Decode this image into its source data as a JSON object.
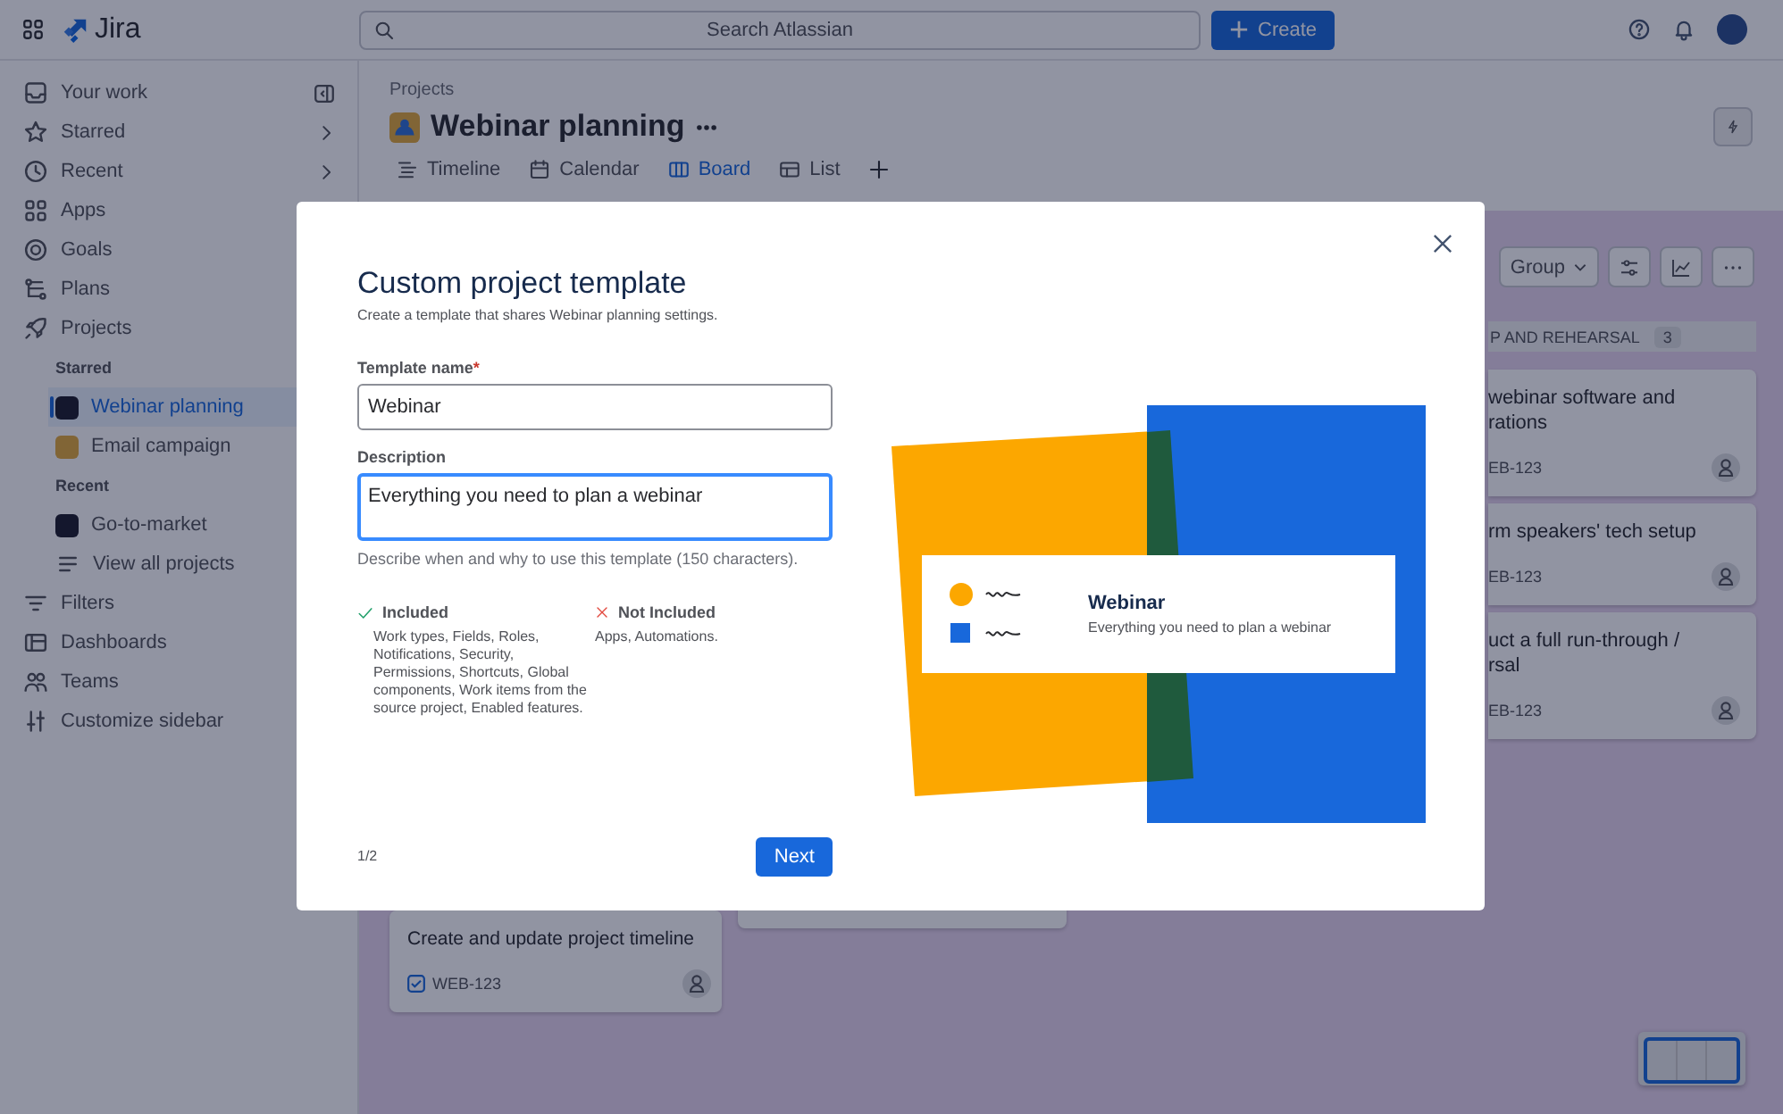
{
  "top_bar": {
    "product": "Jira",
    "search": {
      "placeholder": "Search Atlassian"
    },
    "create_button": "Create"
  },
  "sidebar": {
    "items": [
      {
        "kind": "nav",
        "label": "Your work",
        "selected": false
      },
      {
        "kind": "flyout",
        "label": "Starred",
        "selected": false
      },
      {
        "kind": "flyout",
        "label": "Recent",
        "selected": false
      },
      {
        "kind": "nav",
        "label": "Apps",
        "selected": false
      },
      {
        "kind": "nav",
        "label": "Goals",
        "selected": false
      },
      {
        "kind": "nav",
        "label": "Plans",
        "selected": false
      },
      {
        "kind": "nav",
        "label": "Projects",
        "selected": false
      },
      {
        "kind": "heading",
        "label": "Starred"
      },
      {
        "kind": "project",
        "label": "Webinar planning",
        "selected": true
      },
      {
        "kind": "project",
        "label": "Email campaign",
        "selected": false
      },
      {
        "kind": "heading",
        "label": "Recent"
      },
      {
        "kind": "project",
        "label": "Go-to-market",
        "selected": false
      },
      {
        "kind": "nav",
        "label": "View all projects",
        "selected": false
      },
      {
        "kind": "nav",
        "label": "Filters",
        "selected": false
      },
      {
        "kind": "nav",
        "label": "Dashboards",
        "selected": false
      },
      {
        "kind": "nav",
        "label": "Teams",
        "selected": false
      },
      {
        "kind": "nav",
        "label": "Customize sidebar",
        "selected": false
      }
    ]
  },
  "project": {
    "breadcrumb": "Projects",
    "title": "Webinar planning",
    "tabs": [
      {
        "label": "Timeline",
        "selected": false
      },
      {
        "label": "Calendar",
        "selected": false
      },
      {
        "label": "Board",
        "selected": true
      },
      {
        "label": "List",
        "selected": false
      }
    ],
    "toolbar": {
      "group_button": "Group"
    },
    "columns": [
      {
        "kind": "cards",
        "cards": [
          {
            "title": "Create and update project timeline",
            "key": "WEB-123"
          }
        ]
      },
      {
        "kind": "covered"
      },
      {
        "kind": "cards",
        "header": "P AND REHEARSAL",
        "count": "3",
        "cards": [
          {
            "title": "webinar software and rations",
            "key": "EB-123"
          },
          {
            "title": "rm speakers' tech setup",
            "key": "EB-123"
          },
          {
            "title": "uct a full run-through / rsal",
            "key": "EB-123"
          }
        ]
      }
    ]
  },
  "modal": {
    "title": "Custom project template",
    "subtitle": "Create a template that shares Webinar planning settings.",
    "fields": [
      {
        "label": "Template name",
        "required_mark": "*",
        "value": "Webinar",
        "focused": false
      },
      {
        "label": "Description",
        "value": "Everything you need to plan a webinar",
        "focused": true
      }
    ],
    "helper": "Describe when and why to use this template (150 characters).",
    "included": {
      "heading": "Included",
      "text": "Work types, Fields, Roles, Notifications, Security, Permissions, Shortcuts, Global components, Work items from the source project, Enabled features."
    },
    "not_included": {
      "heading": "Not Included",
      "text": "Apps, Automations."
    },
    "preview": {
      "title": "Webinar",
      "text": "Everything you need to plan a webinar"
    },
    "step": "1/2",
    "next_button": "Next"
  }
}
